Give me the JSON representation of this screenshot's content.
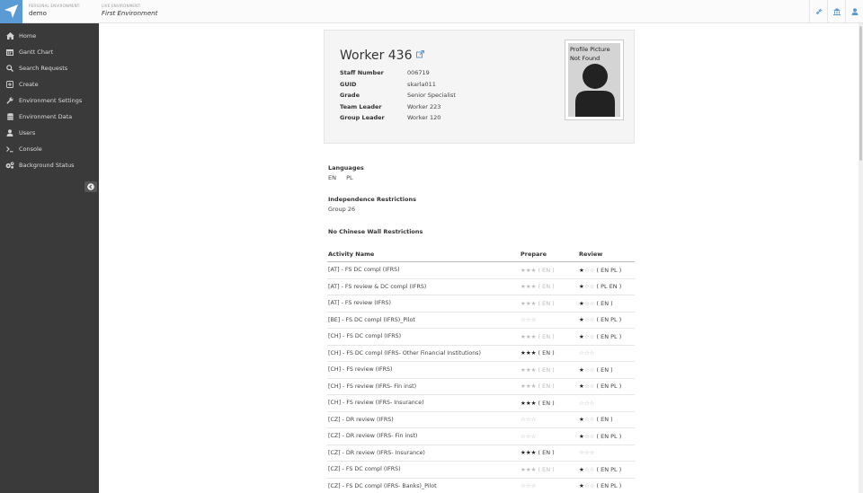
{
  "header": {
    "personal_env_label": "PERSONAL ENVIRONMENT:",
    "personal_env_value": "demo",
    "live_env_label": "LIVE ENVIRONMENT:",
    "live_env_value": "First Environment",
    "icons": [
      "link-icon",
      "bank-icon",
      "user-icon"
    ]
  },
  "sidebar": {
    "items": [
      {
        "label": "Home",
        "icon": "home-icon"
      },
      {
        "label": "Gantt Chart",
        "icon": "calendar-icon"
      },
      {
        "label": "Search Requests",
        "icon": "search-icon"
      },
      {
        "label": "Create",
        "icon": "plus-square-icon"
      },
      {
        "label": "Environment Settings",
        "icon": "wrench-icon"
      },
      {
        "label": "Environment Data",
        "icon": "database-icon"
      },
      {
        "label": "Users",
        "icon": "user-icon"
      },
      {
        "label": "Console",
        "icon": "terminal-icon"
      },
      {
        "label": "Background Status",
        "icon": "cogs-icon"
      }
    ]
  },
  "profile": {
    "name": "Worker 436",
    "fields": [
      {
        "key": "Staff Number",
        "value": "006719"
      },
      {
        "key": "GUID",
        "value": "skarla011"
      },
      {
        "key": "Grade",
        "value": "Senior Specialist"
      },
      {
        "key": "Team Leader",
        "value": "Worker 223"
      },
      {
        "key": "Group Leader",
        "value": "Worker 120"
      }
    ],
    "picture_text": "Profile Picture Not Found"
  },
  "languages": {
    "title": "Languages",
    "values": [
      "EN",
      "PL"
    ]
  },
  "independence": {
    "title": "Independence Restrictions",
    "value": "Group 26"
  },
  "chinese_wall": {
    "title": "No Chinese Wall Restrictions"
  },
  "activities": {
    "headers": {
      "name": "Activity Name",
      "prepare": "Prepare",
      "review": "Review"
    },
    "rows": [
      {
        "name": "[AT] - FS DC compl (IFRS)",
        "prepare": {
          "stars": 3,
          "muted": true,
          "langs": "( EN )"
        },
        "review": {
          "stars": 1,
          "muted": false,
          "langs": "( EN PL )"
        }
      },
      {
        "name": "[AT] - FS review & DC compl (IFRS)",
        "prepare": {
          "stars": 3,
          "muted": true,
          "langs": "( EN )"
        },
        "review": {
          "stars": 1,
          "muted": false,
          "langs": "( PL EN )"
        }
      },
      {
        "name": "[AT] - FS review (IFRS)",
        "prepare": {
          "stars": 3,
          "muted": true,
          "langs": "( EN )"
        },
        "review": {
          "stars": 1,
          "muted": false,
          "langs": "( EN )"
        }
      },
      {
        "name": "[BE] - FS DC compl (IFRS)_Pilot",
        "prepare": {
          "stars": 0,
          "muted": false,
          "langs": ""
        },
        "review": {
          "stars": 1,
          "muted": false,
          "langs": "( EN PL )"
        }
      },
      {
        "name": "[CH] - FS DC compl (IFRS)",
        "prepare": {
          "stars": 3,
          "muted": true,
          "langs": "( EN )"
        },
        "review": {
          "stars": 1,
          "muted": false,
          "langs": "( EN PL )"
        }
      },
      {
        "name": "[CH] - FS DC compl (IFRS- Other Financial Institutions)",
        "prepare": {
          "stars": 3,
          "muted": false,
          "langs": "( EN )"
        },
        "review": {
          "stars": 0,
          "muted": false,
          "langs": ""
        }
      },
      {
        "name": "[CH] - FS review (IFRS)",
        "prepare": {
          "stars": 3,
          "muted": true,
          "langs": "( EN )"
        },
        "review": {
          "stars": 1,
          "muted": false,
          "langs": "( EN )"
        }
      },
      {
        "name": "[CH] - FS review (IFRS- Fin inst)",
        "prepare": {
          "stars": 3,
          "muted": true,
          "langs": "( EN )"
        },
        "review": {
          "stars": 1,
          "muted": false,
          "langs": "( EN PL )"
        }
      },
      {
        "name": "[CH] - FS review (IFRS- Insurance)",
        "prepare": {
          "stars": 3,
          "muted": false,
          "langs": "( EN )"
        },
        "review": {
          "stars": 0,
          "muted": false,
          "langs": ""
        }
      },
      {
        "name": "[CZ] - DR review (IFRS)",
        "prepare": {
          "stars": 0,
          "muted": false,
          "langs": ""
        },
        "review": {
          "stars": 1,
          "muted": false,
          "langs": "( EN )"
        }
      },
      {
        "name": "[CZ] - DR review (IFRS- Fin inst)",
        "prepare": {
          "stars": 0,
          "muted": false,
          "langs": ""
        },
        "review": {
          "stars": 1,
          "muted": false,
          "langs": "( EN PL )"
        }
      },
      {
        "name": "[CZ] - DR review (IFRS- Insurance)",
        "prepare": {
          "stars": 3,
          "muted": false,
          "langs": "( EN )"
        },
        "review": {
          "stars": 0,
          "muted": false,
          "langs": ""
        }
      },
      {
        "name": "[CZ] - FS DC compl (IFRS)",
        "prepare": {
          "stars": 3,
          "muted": true,
          "langs": "( EN )"
        },
        "review": {
          "stars": 1,
          "muted": false,
          "langs": "( EN PL )"
        }
      },
      {
        "name": "[CZ] - FS DC compl (IFRS- Banks)_Pilot",
        "prepare": {
          "stars": 0,
          "muted": false,
          "langs": ""
        },
        "review": {
          "stars": 1,
          "muted": false,
          "langs": "( EN PL )"
        }
      }
    ]
  },
  "colors": {
    "accent": "#5b9bd5",
    "sidebar_bg": "#3a3a3a"
  }
}
